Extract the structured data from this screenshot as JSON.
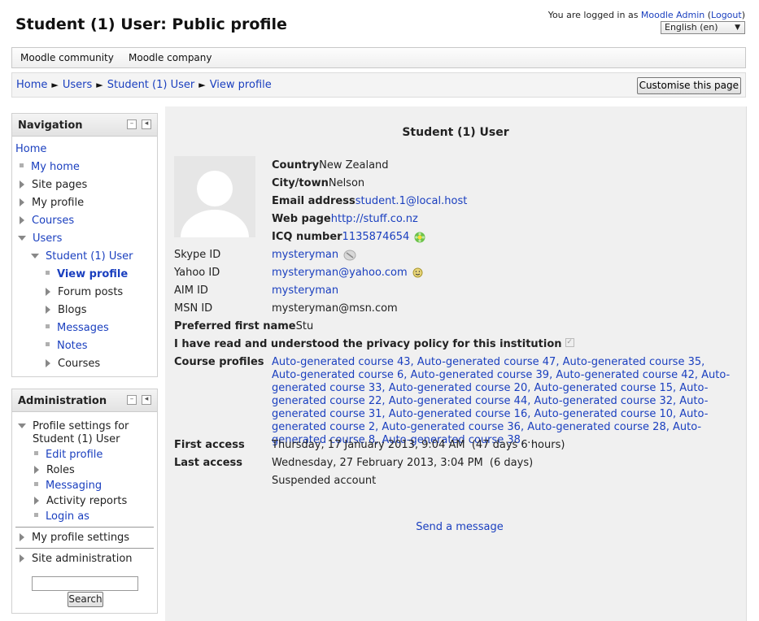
{
  "page": {
    "title": "Student (1) User: Public profile"
  },
  "login": {
    "prefix": "You are logged in as ",
    "user": "Moodle Admin",
    "logout_open": " (",
    "logout": "Logout",
    "logout_close": ")"
  },
  "language": {
    "selected": "English (en)"
  },
  "custommenu": {
    "items": [
      "Moodle community",
      "Moodle company"
    ]
  },
  "breadcrumb": {
    "items": [
      "Home",
      "Users",
      "Student (1) User",
      "View profile"
    ],
    "separator": "►"
  },
  "customise_button": "Customise this page",
  "navigation": {
    "title": "Navigation",
    "home": "Home",
    "items": [
      {
        "label": "My home"
      },
      {
        "label": "Site pages"
      },
      {
        "label": "My profile"
      },
      {
        "label": "Courses"
      },
      {
        "label": "Users"
      },
      {
        "label": "Student (1) User"
      },
      {
        "label": "View profile"
      },
      {
        "label": "Forum posts"
      },
      {
        "label": "Blogs"
      },
      {
        "label": "Messages"
      },
      {
        "label": "Notes"
      },
      {
        "label": "Courses"
      }
    ]
  },
  "administration": {
    "title": "Administration",
    "profile_settings_line1": "Profile settings for",
    "profile_settings_line2": "Student (1) User",
    "items": [
      {
        "label": "Edit profile"
      },
      {
        "label": "Roles"
      },
      {
        "label": "Messaging"
      },
      {
        "label": "Activity reports"
      },
      {
        "label": "Login as"
      }
    ],
    "my_profile_settings": "My profile settings",
    "site_administration": "Site administration",
    "search_button": "Search",
    "search_value": ""
  },
  "profile": {
    "fullname": "Student (1) User",
    "country_label": "Country",
    "country": "New Zealand",
    "city_label": "City/town",
    "city": "Nelson",
    "email_label": "Email address",
    "email": "student.1@local.host",
    "webpage_label": "Web page",
    "webpage": "http://stuff.co.nz",
    "icq_label": "ICQ number",
    "icq": "1135874654",
    "skype_label": "Skype ID",
    "skype": "mysteryman",
    "yahoo_label": "Yahoo ID",
    "yahoo": "mysteryman@yahoo.com",
    "aim_label": "AIM ID",
    "aim": "mysteryman",
    "msn_label": "MSN ID",
    "msn": "mysteryman@msn.com",
    "preferred_label": "Preferred first name",
    "preferred": "Stu",
    "privacy_label": "I have read and understood the privacy policy for this institution",
    "privacy_checked": true,
    "course_profiles_label": "Course profiles",
    "courses": [
      "Auto-generated course 43",
      "Auto-generated course 47",
      "Auto-generated course 35",
      "Auto-generated course 6",
      "Auto-generated course 39",
      "Auto-generated course 42",
      "Auto-generated course 33",
      "Auto-generated course 20",
      "Auto-generated course 15",
      "Auto-generated course 22",
      "Auto-generated course 44",
      "Auto-generated course 32",
      "Auto-generated course 31",
      "Auto-generated course 16",
      "Auto-generated course 10",
      "Auto-generated course 2",
      "Auto-generated course 36",
      "Auto-generated course 28",
      "Auto-generated course 8",
      "Auto-generated course 38"
    ],
    "courses_more": "...",
    "first_access_label": "First access",
    "first_access": "Thursday, 17 January 2013, 9:04 AM  (47 days 6 hours)",
    "last_access_label": "Last access",
    "last_access": "Wednesday, 27 February 2013, 3:04 PM  (6 days)",
    "suspended": "Suspended account",
    "send_message": "Send a message"
  },
  "colors": {
    "link": "#1a3fbf",
    "main_background": "#f0f0f0",
    "block_header": "#e2e2e2"
  }
}
